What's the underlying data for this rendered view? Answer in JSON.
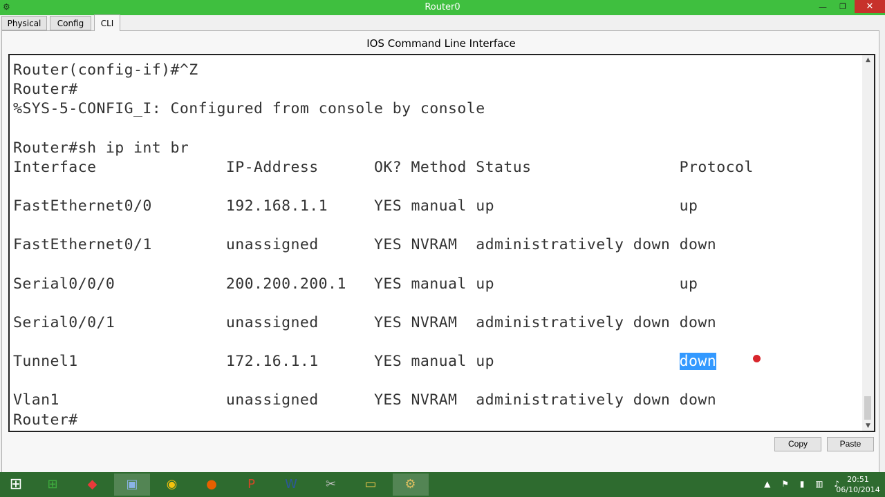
{
  "window": {
    "title": "Router0",
    "minimize_glyph": "—",
    "maximize_glyph": "❐",
    "close_glyph": "✕",
    "icon": "packet-tracer-icon"
  },
  "tabs": [
    {
      "label": "Physical"
    },
    {
      "label": "Config"
    },
    {
      "label": "CLI"
    }
  ],
  "panel": {
    "title": "IOS Command Line Interface"
  },
  "terminal": {
    "lines": [
      "Router(config-if)#^Z",
      "Router#",
      "%SYS-5-CONFIG_I: Configured from console by console",
      "",
      "Router#sh ip int br",
      "Interface              IP-Address      OK? Method Status                Protocol",
      "",
      "FastEthernet0/0        192.168.1.1     YES manual up                    up",
      "",
      "FastEthernet0/1        unassigned      YES NVRAM  administratively down down",
      "",
      "Serial0/0/0            200.200.200.1   YES manual up                    up",
      "",
      "Serial0/0/1            unassigned      YES NVRAM  administratively down down",
      "",
      "Tunnel1                172.16.1.1      YES manual up                    ",
      "",
      "Vlan1                  unassigned      YES NVRAM  administratively down down",
      "Router#"
    ],
    "selected_text": "down",
    "scroll_up_glyph": "▲",
    "scroll_down_glyph": "▼"
  },
  "buttons": {
    "copy": "Copy",
    "paste": "Paste"
  },
  "taskbar": {
    "start_glyph": "⊞",
    "apps": [
      {
        "icon": "store-icon",
        "glyph": "⊞",
        "color": "#3fae3f"
      },
      {
        "icon": "app-icon",
        "glyph": "◆",
        "color": "#e83a3a"
      },
      {
        "icon": "video-icon",
        "glyph": "▣",
        "color": "#8ab4e8"
      },
      {
        "icon": "chrome-icon",
        "glyph": "◉",
        "color": "#f4c20d"
      },
      {
        "icon": "firefox-icon",
        "glyph": "●",
        "color": "#e66000"
      },
      {
        "icon": "powerpoint-icon",
        "glyph": "P",
        "color": "#d24726"
      },
      {
        "icon": "word-icon",
        "glyph": "W",
        "color": "#2b579a"
      },
      {
        "icon": "snipping-icon",
        "glyph": "✂",
        "color": "#c0c0c0"
      },
      {
        "icon": "explorer-icon",
        "glyph": "▭",
        "color": "#f2c94c"
      },
      {
        "icon": "packet-tracer-icon",
        "glyph": "⚙",
        "color": "#e0c060"
      }
    ],
    "tray_glyphs": "▲ ⚑ ▮ ▥ ♪",
    "time": "20:51",
    "date": "06/10/2014"
  }
}
